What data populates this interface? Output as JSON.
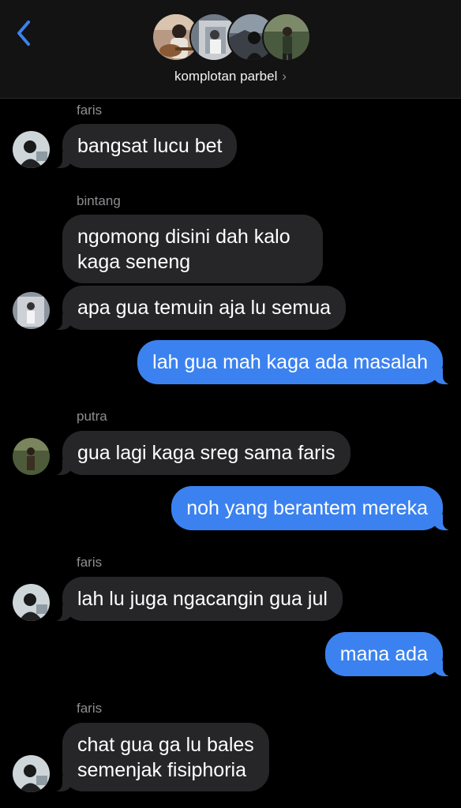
{
  "header": {
    "group_name": "komplotan parbel",
    "chevron": "›",
    "back_icon": "chevron-left-icon"
  },
  "messages": [
    {
      "sender": "faris"
    },
    {
      "text": "bangsat lucu bet"
    },
    {
      "sender": "bintang"
    },
    {
      "text_lines": [
        "ngomong disini dah kalo",
        "kaga seneng"
      ]
    },
    {
      "text": "apa gua temuin aja lu semua"
    },
    {
      "text": "lah gua mah kaga ada masalah"
    },
    {
      "sender": "putra"
    },
    {
      "text": "gua lagi kaga sreg sama faris"
    },
    {
      "text": "noh yang berantem mereka"
    },
    {
      "sender": "faris"
    },
    {
      "text": "lah lu juga ngacangin gua jul"
    },
    {
      "text": "mana ada"
    },
    {
      "sender": "faris"
    },
    {
      "text_lines": [
        "chat gua ga lu bales",
        "semenjak fisiphoria"
      ]
    }
  ],
  "colors": {
    "incoming_bubble": "#262628",
    "outgoing_bubble": "#3b82f0",
    "sender_label": "#8e8e93",
    "back_accent": "#3b82f0"
  }
}
